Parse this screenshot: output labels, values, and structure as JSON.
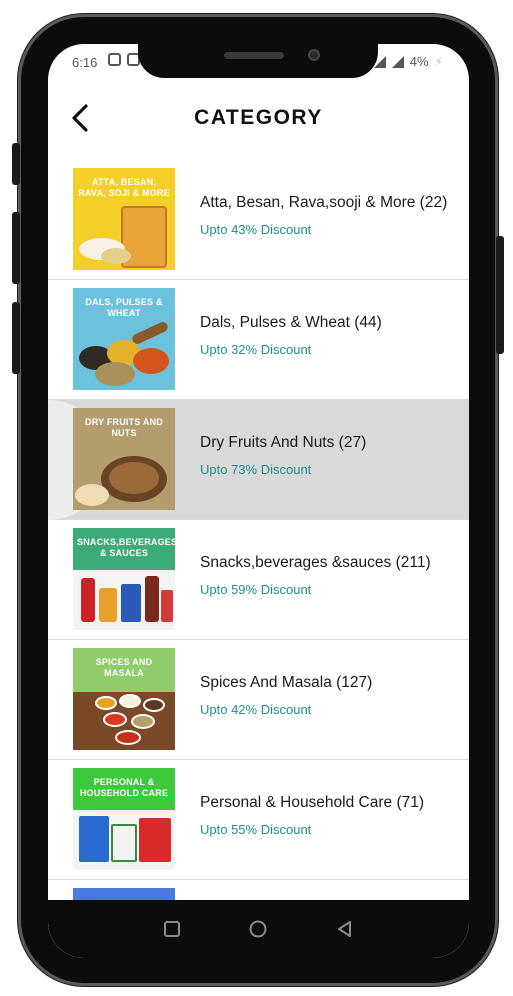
{
  "status_bar": {
    "time": "6:16",
    "battery": "4%"
  },
  "header": {
    "title": "CATEGORY"
  },
  "categories": [
    {
      "title": "Atta, Besan, Rava,sooji & More (22)",
      "discount": "Upto 43% Discount",
      "thumb_label": "ATTA, BESAN, RAVA, SOJI & MORE",
      "thumb_color": "#f4cf2a"
    },
    {
      "title": "Dals, Pulses & Wheat (44)",
      "discount": "Upto 32% Discount",
      "thumb_label": "DALS, PULSES & WHEAT",
      "thumb_color": "#6cc2dc"
    },
    {
      "title": "Dry Fruits And Nuts (27)",
      "discount": "Upto 73% Discount",
      "thumb_label": "DRY FRUITS AND NUTS",
      "thumb_color": "#b39d6e"
    },
    {
      "title": "Snacks,beverages &sauces (211)",
      "discount": "Upto 59% Discount",
      "thumb_label": "SNACKS,BEVERAGES & SAUCES",
      "thumb_color": "#3daa7a"
    },
    {
      "title": "Spices And Masala (127)",
      "discount": "Upto 42% Discount",
      "thumb_label": "SPICES AND MASALA",
      "thumb_color": "#8fcc6a"
    },
    {
      "title": "Personal & Household Care (71)",
      "discount": "Upto 55% Discount",
      "thumb_label": "PERSONAL & HOUSEHOLD CARE",
      "thumb_color": "#3cc93c"
    }
  ],
  "colors": {
    "accent": "#1e8f8f",
    "active_row": "#d9d9d9"
  },
  "icons": {
    "back": "back-arrow-icon",
    "nav": [
      "square-icon",
      "circle-icon",
      "triangle-back-icon"
    ]
  }
}
